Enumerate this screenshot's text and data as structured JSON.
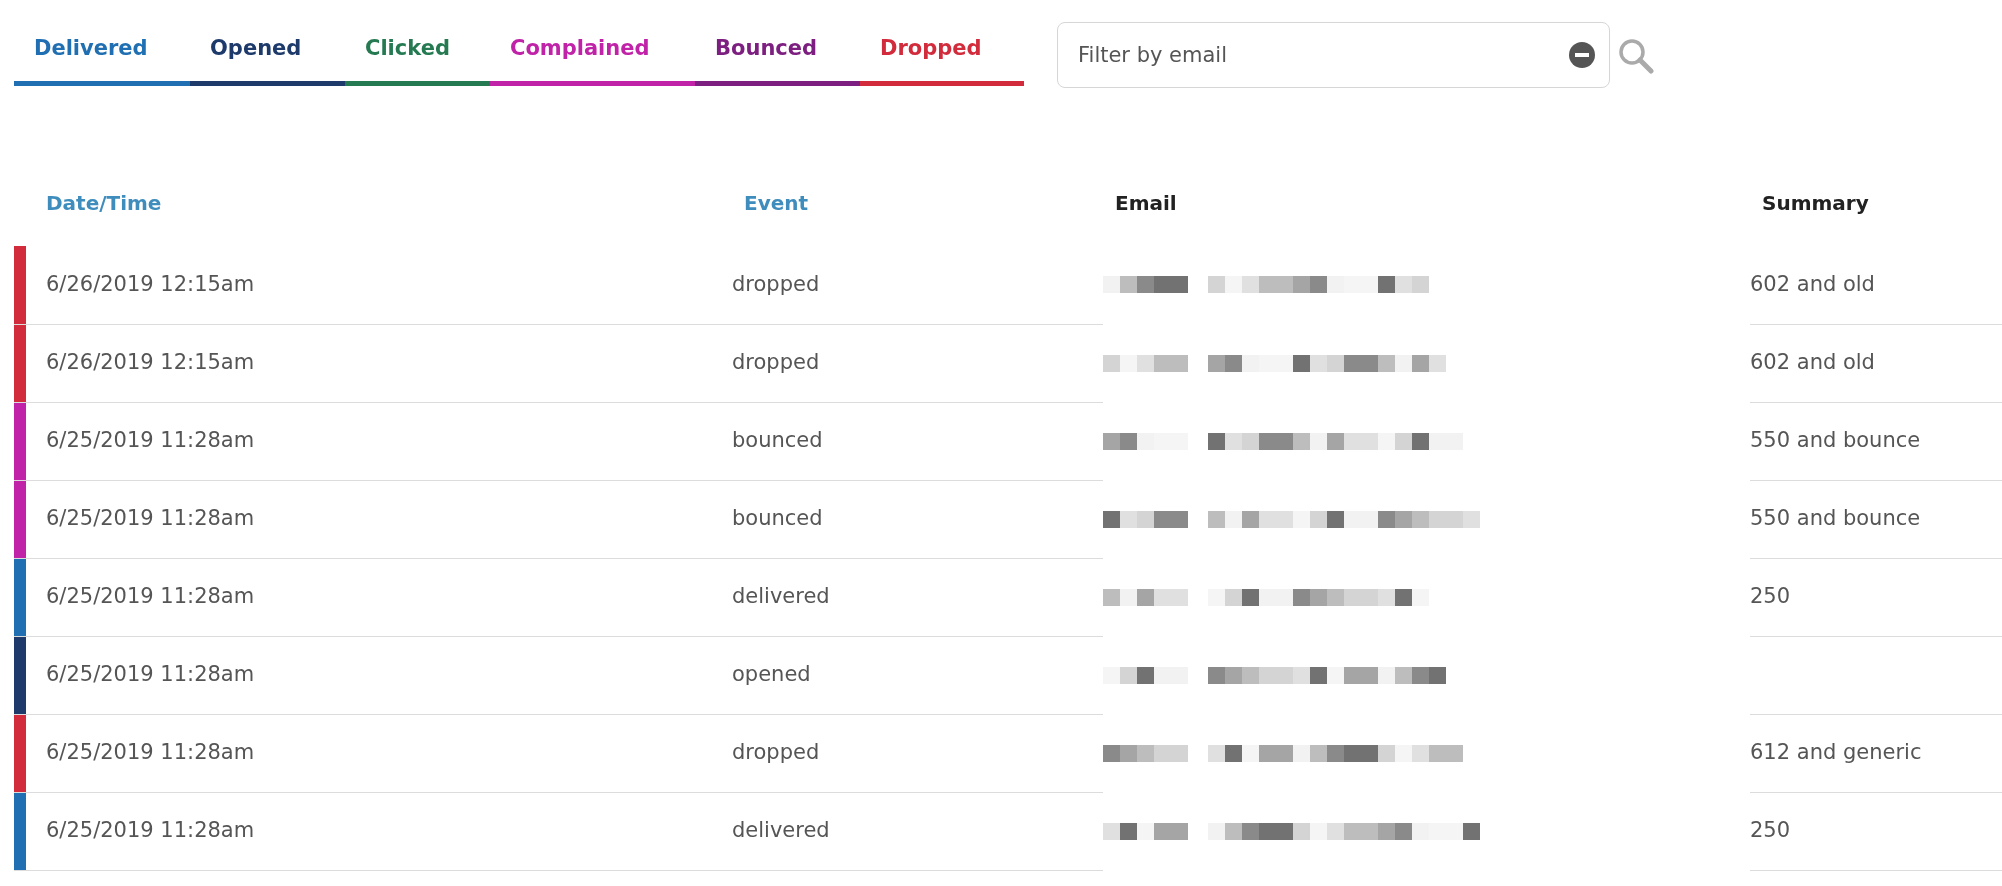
{
  "tabs": [
    {
      "label": "Delivered",
      "color": "#1f6fb2"
    },
    {
      "label": "Opened",
      "color": "#1d3a6b"
    },
    {
      "label": "Clicked",
      "color": "#257a52"
    },
    {
      "label": "Complained",
      "color": "#c022a8"
    },
    {
      "label": "Bounced",
      "color": "#7d1f80"
    },
    {
      "label": "Dropped",
      "color": "#d22b3b"
    }
  ],
  "filter": {
    "placeholder": "Filter by email"
  },
  "table": {
    "columns": [
      {
        "label": "Date/Time",
        "sortable": true
      },
      {
        "label": "Event",
        "sortable": true
      },
      {
        "label": "Email",
        "sortable": false
      },
      {
        "label": "Summary",
        "sortable": false
      }
    ],
    "rows": [
      {
        "datetime": "6/26/2019 12:15am",
        "event": "dropped",
        "summary": "602 and old",
        "color": "#d22b3b"
      },
      {
        "datetime": "6/26/2019 12:15am",
        "event": "dropped",
        "summary": "602 and old",
        "color": "#d22b3b"
      },
      {
        "datetime": "6/25/2019 11:28am",
        "event": "bounced",
        "summary": "550 and bounce",
        "color": "#c022a8"
      },
      {
        "datetime": "6/25/2019 11:28am",
        "event": "bounced",
        "summary": "550 and bounce",
        "color": "#c022a8"
      },
      {
        "datetime": "6/25/2019 11:28am",
        "event": "delivered",
        "summary": "250",
        "color": "#1f6fb2"
      },
      {
        "datetime": "6/25/2019 11:28am",
        "event": "opened",
        "color": "#1d3a6b"
      },
      {
        "datetime": "6/25/2019 11:28am",
        "event": "dropped",
        "summary": "612 and generic",
        "color": "#d22b3b"
      },
      {
        "datetime": "6/25/2019 11:28am",
        "event": "delivered",
        "summary": "250",
        "color": "#1f6fb2"
      }
    ]
  }
}
